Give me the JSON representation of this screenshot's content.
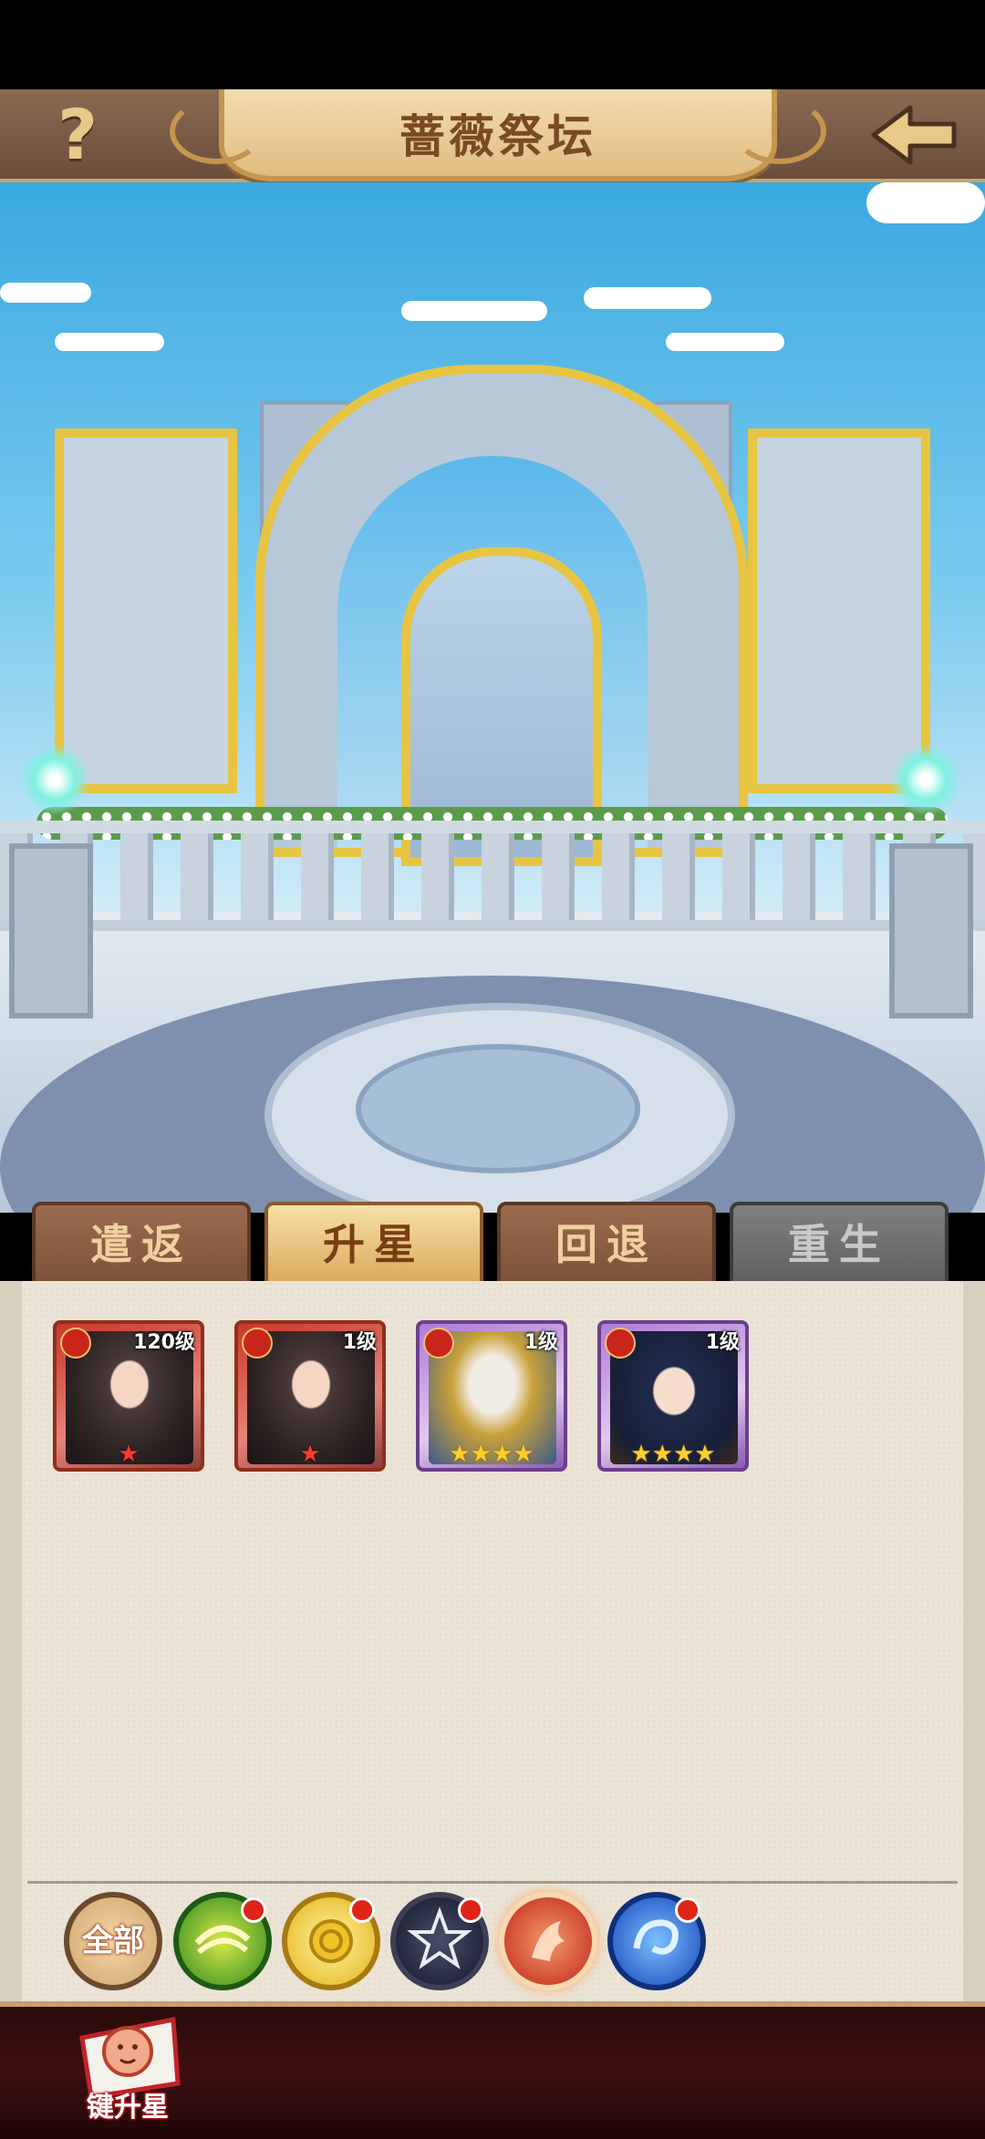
{
  "header": {
    "title": "蔷薇祭坛",
    "help_icon": "?",
    "back_icon": "back-arrow-icon"
  },
  "tabs": [
    {
      "label": "遣返",
      "state": "normal"
    },
    {
      "label": "升星",
      "state": "active"
    },
    {
      "label": "回退",
      "state": "normal"
    },
    {
      "label": "重生",
      "state": "disabled"
    }
  ],
  "heroes": [
    {
      "level": "120级",
      "stars": "★",
      "star_color": "red",
      "frame": "red"
    },
    {
      "level": "1级",
      "stars": "★",
      "star_color": "red",
      "frame": "red"
    },
    {
      "level": "1级",
      "stars": "★★★★",
      "star_color": "gold",
      "frame": "purple"
    },
    {
      "level": "1级",
      "stars": "★★★★",
      "star_color": "gold",
      "frame": "purple"
    }
  ],
  "filters": {
    "all_label": "全部",
    "items": [
      "nature-faction-icon",
      "rose-faction-icon",
      "dark-star-faction-icon",
      "phoenix-faction-icon",
      "water-serpent-faction-icon"
    ]
  },
  "bottom": {
    "one_key_star_label": "键升星"
  },
  "colors": {
    "accent_gold": "#c4964f",
    "bar_brown": "#6b4d3b",
    "panel_parchment": "#eae3d6",
    "bottom_dark_red": "#3f0f10"
  }
}
